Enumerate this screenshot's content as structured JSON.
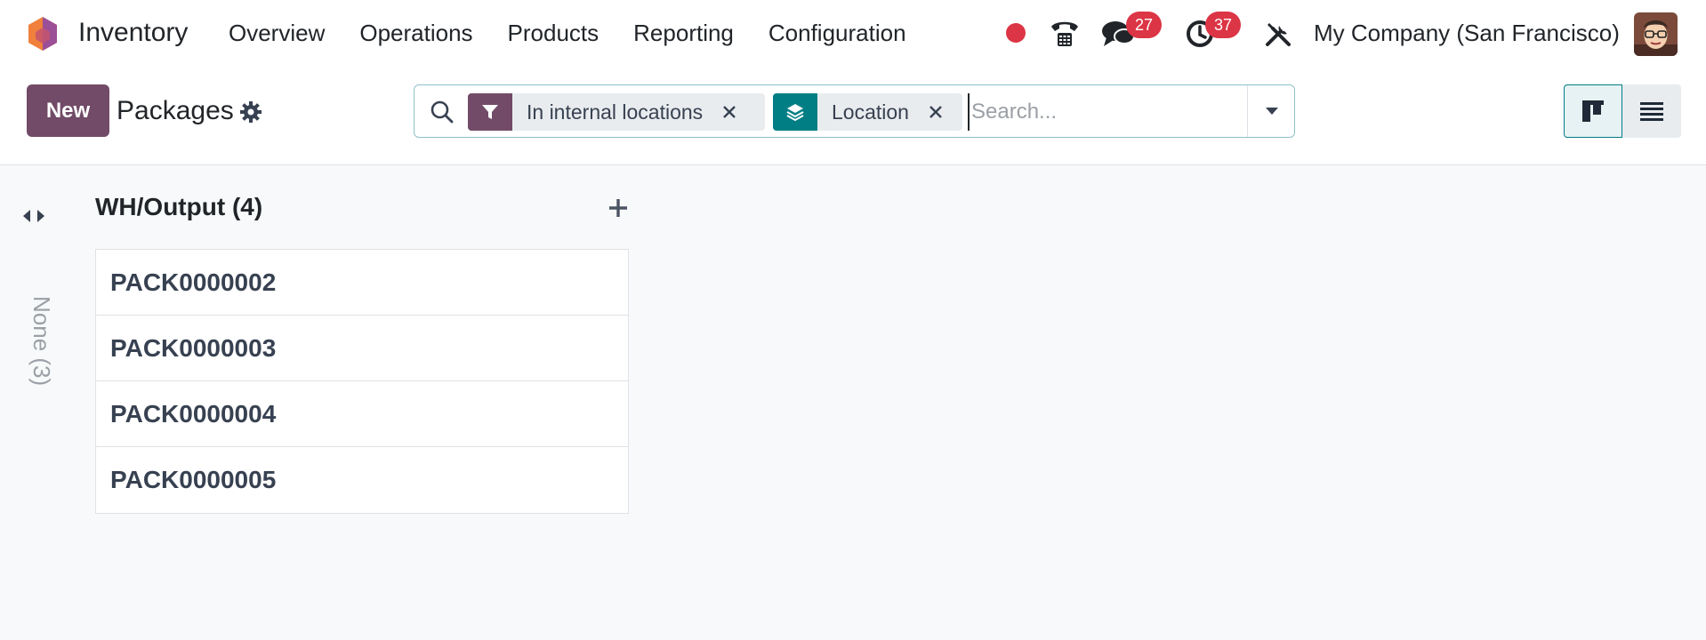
{
  "app": {
    "name": "Inventory",
    "logo_icon": "odoo-app-icon"
  },
  "menu": {
    "items": [
      "Overview",
      "Operations",
      "Products",
      "Reporting",
      "Configuration"
    ]
  },
  "systray": {
    "messages_count": "27",
    "activities_count": "37",
    "company": "My Company (San Francisco)"
  },
  "control": {
    "new_label": "New",
    "title": "Packages"
  },
  "search": {
    "facets": [
      {
        "label": "In internal locations",
        "icon": "filter-icon"
      },
      {
        "label": "Location",
        "icon": "group-by-icon"
      }
    ],
    "placeholder": "Search..."
  },
  "kanban": {
    "folded_group": "None (3)",
    "column": {
      "title": "WH/Output (4)",
      "cards": [
        "PACK0000002",
        "PACK0000003",
        "PACK0000004",
        "PACK0000005"
      ]
    }
  },
  "colors": {
    "brand": "#714b67",
    "teal": "#017e84",
    "badge": "#dc3545"
  }
}
